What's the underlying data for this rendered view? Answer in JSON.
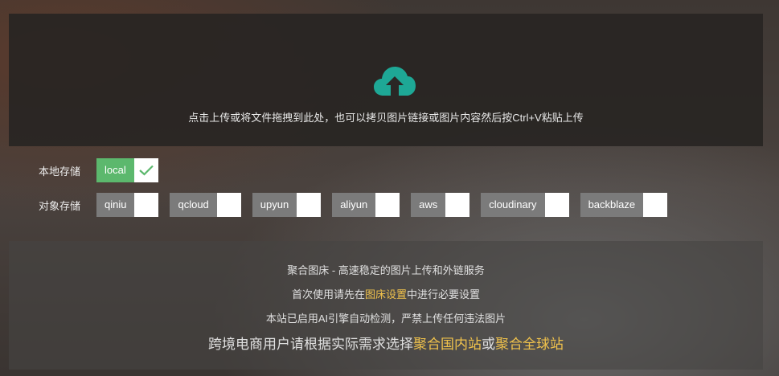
{
  "upload": {
    "icon": "cloud-upload-icon",
    "text": "点击上传或将文件拖拽到此处，也可以拷贝图片链接或图片内容然后按Ctrl+V粘贴上传",
    "icon_color": "#1ea896"
  },
  "local_storage": {
    "label": "本地存储",
    "options": [
      {
        "name": "local",
        "checked": true
      }
    ]
  },
  "object_storage": {
    "label": "对象存储",
    "options": [
      {
        "name": "qiniu",
        "checked": false
      },
      {
        "name": "qcloud",
        "checked": false
      },
      {
        "name": "upyun",
        "checked": false
      },
      {
        "name": "aliyun",
        "checked": false
      },
      {
        "name": "aws",
        "checked": false
      },
      {
        "name": "cloudinary",
        "checked": false
      },
      {
        "name": "backblaze",
        "checked": false
      }
    ]
  },
  "info": {
    "line1": "聚合图床 - 高速稳定的图片上传和外链服务",
    "line2_pre": "首次使用请先在",
    "line2_link": "图床设置",
    "line2_post": "中进行必要设置",
    "line3": "本站已启用AI引擎自动检测，严禁上传任何违法图片",
    "line4_pre": "跨境电商用户请根据实际需求选择",
    "line4_link1": "聚合国内站",
    "line4_mid": "或",
    "line4_link2": "聚合全球站",
    "highlight_color": "#f0c24c"
  },
  "colors": {
    "checked": "#5cb86d",
    "unchecked": "#7b7b7b"
  }
}
